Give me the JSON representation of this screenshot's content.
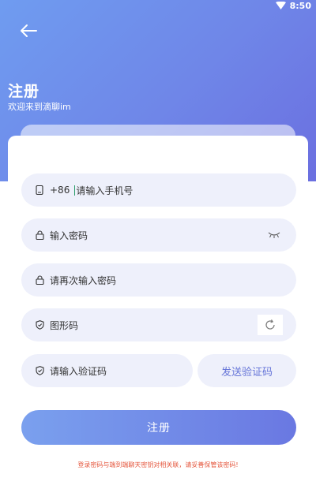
{
  "status_bar": {
    "time": "8:50",
    "wifi_icon": "wifi-icon"
  },
  "header": {
    "back_icon": "arrow-left-icon",
    "title": "注册",
    "subtitle": "欢迎来到滴聊im"
  },
  "form": {
    "phone": {
      "prefix": "+86",
      "placeholder": "请输入手机号",
      "icon": "phone-icon"
    },
    "password": {
      "placeholder": "输入密码",
      "icon": "lock-icon",
      "toggle_icon": "eye-closed-icon"
    },
    "confirm_password": {
      "placeholder": "请再次输入密码",
      "icon": "lock-icon"
    },
    "captcha": {
      "placeholder": "图形码",
      "icon": "shield-icon",
      "refresh_icon": "refresh-icon"
    },
    "sms_code": {
      "placeholder": "请输入验证码",
      "icon": "shield-icon"
    },
    "send_code_label": "发送验证码",
    "submit_label": "注册"
  },
  "notice": "登录密码与端到端聊天密钥对相关联，请妥善保管该密码!",
  "colors": {
    "header_gradient_start": "#6f9cf0",
    "header_gradient_end": "#6b6fe0",
    "field_bg": "#eef0fb",
    "accent_text": "#6675d8",
    "notice_text": "#e5573e"
  }
}
